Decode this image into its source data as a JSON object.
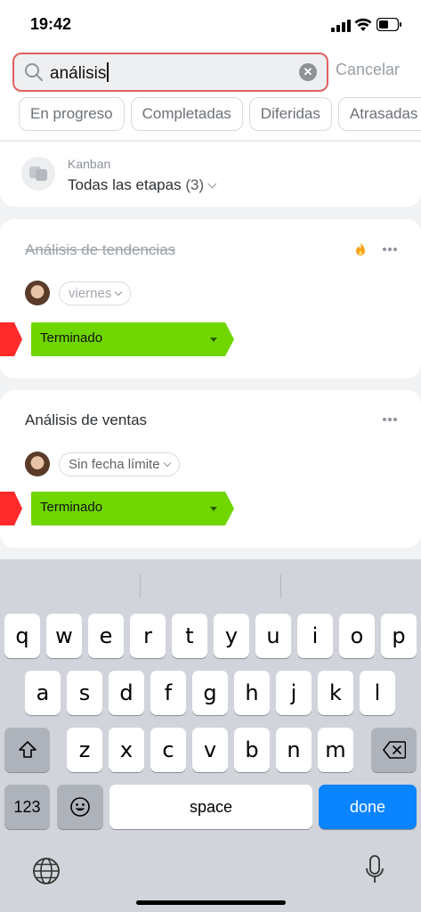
{
  "status_bar": {
    "time": "19:42"
  },
  "search": {
    "query": "análisis",
    "cancel_label": "Cancelar"
  },
  "filters": [
    "En progreso",
    "Completadas",
    "Diferidas",
    "Atrasadas"
  ],
  "kanban": {
    "label": "Kanban",
    "stage": "Todas las etapas",
    "count": "(3)"
  },
  "tasks": [
    {
      "title": "Análisis de tendencias",
      "completed": true,
      "deadline": "viernes",
      "stage": "Terminado",
      "hot": true
    },
    {
      "title": "Análisis de ventas",
      "completed": false,
      "deadline": "Sin fecha límite",
      "stage": "Terminado",
      "hot": false
    }
  ],
  "keyboard": {
    "row1": [
      "q",
      "w",
      "e",
      "r",
      "t",
      "y",
      "u",
      "i",
      "o",
      "p"
    ],
    "row2": [
      "a",
      "s",
      "d",
      "f",
      "g",
      "h",
      "j",
      "k",
      "l"
    ],
    "row3": [
      "z",
      "x",
      "c",
      "v",
      "b",
      "n",
      "m"
    ],
    "numbers_label": "123",
    "space_label": "space",
    "done_label": "done"
  },
  "colors": {
    "stage_green": "#6fd600",
    "flag_red": "#ff2a2a",
    "search_border": "#e06060",
    "done_blue": "#0a84ff"
  }
}
